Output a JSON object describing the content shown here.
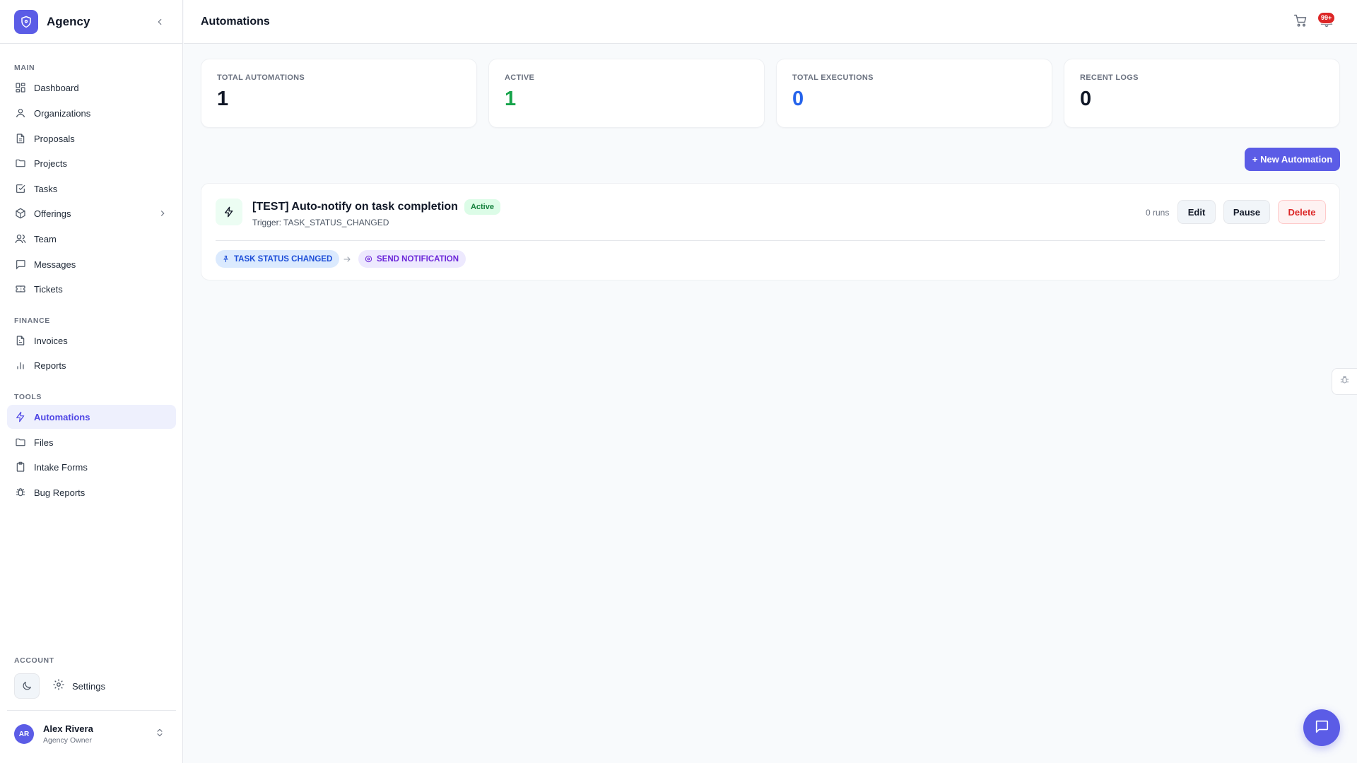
{
  "brand": {
    "name": "Agency",
    "accent": "#5b5ce6"
  },
  "sidebar": {
    "sections": {
      "main": "MAIN",
      "finance": "FINANCE",
      "tools": "TOOLS",
      "account": "ACCOUNT"
    },
    "main_items": [
      {
        "label": "Dashboard",
        "icon": "grid-icon"
      },
      {
        "label": "Organizations",
        "icon": "user-icon"
      },
      {
        "label": "Proposals",
        "icon": "document-icon"
      },
      {
        "label": "Projects",
        "icon": "folder-icon"
      },
      {
        "label": "Tasks",
        "icon": "check-square-icon"
      },
      {
        "label": "Offerings",
        "icon": "package-icon"
      },
      {
        "label": "Team",
        "icon": "users-icon"
      },
      {
        "label": "Messages",
        "icon": "message-icon"
      },
      {
        "label": "Tickets",
        "icon": "ticket-icon"
      }
    ],
    "finance_items": [
      {
        "label": "Invoices",
        "icon": "invoice-icon"
      },
      {
        "label": "Reports",
        "icon": "bar-chart-icon"
      }
    ],
    "tools_items": [
      {
        "label": "Automations",
        "icon": "lightning-icon",
        "active": true
      },
      {
        "label": "Files",
        "icon": "folder-icon"
      },
      {
        "label": "Intake Forms",
        "icon": "clipboard-icon"
      },
      {
        "label": "Bug Reports",
        "icon": "bug-icon"
      }
    ],
    "settings_label": "Settings",
    "user": {
      "initials": "AR",
      "name": "Alex Rivera",
      "role": "Agency Owner"
    }
  },
  "header": {
    "title": "Automations",
    "notification_count": "99+"
  },
  "stats": [
    {
      "label": "TOTAL AUTOMATIONS",
      "value": "1",
      "color": "#111827"
    },
    {
      "label": "ACTIVE",
      "value": "1",
      "color": "#16a34a"
    },
    {
      "label": "TOTAL EXECUTIONS",
      "value": "0",
      "color": "#2563eb"
    },
    {
      "label": "RECENT LOGS",
      "value": "0",
      "color": "#111827"
    }
  ],
  "new_button_label": "+ New Automation",
  "automation": {
    "title": "[TEST] Auto-notify on task completion",
    "status": "Active",
    "trigger_text": "Trigger: TASK_STATUS_CHANGED",
    "runs": "0 runs",
    "edit_label": "Edit",
    "pause_label": "Pause",
    "delete_label": "Delete",
    "trigger_chip": "TASK STATUS CHANGED",
    "action_chip": "SEND NOTIFICATION"
  }
}
